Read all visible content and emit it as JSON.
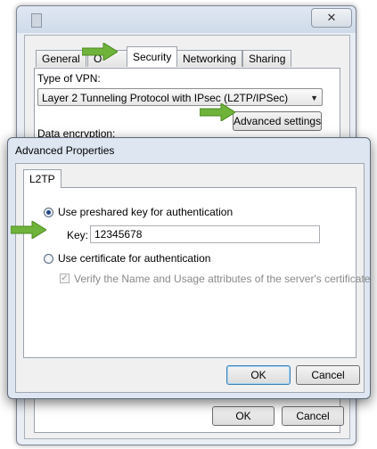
{
  "back_window": {
    "close_glyph": "✕",
    "tabs": [
      "General",
      "O",
      "Security",
      "Networking",
      "Sharing"
    ],
    "active_tab": "Security",
    "type_of_vpn_label": "Type of VPN:",
    "vpn_type_value": "Layer 2 Tunneling Protocol with IPsec (L2TP/IPSec)",
    "advanced_settings_label": "Advanced settings",
    "data_encryption_label": "Data encryption:",
    "ok_label": "OK",
    "cancel_label": "Cancel"
  },
  "dialog": {
    "title": "Advanced Properties",
    "tab": "L2TP",
    "use_preshared_key_label": "Use preshared key for authentication",
    "key_label": "Key:",
    "key_value": "12345678",
    "use_certificate_label": "Use certificate for authentication",
    "verify_label": "Verify the Name and Usage attributes of the server's certificate",
    "ok_label": "OK",
    "cancel_label": "Cancel"
  },
  "icons": {
    "dropdown": "chevron-down-icon",
    "pointer_arrow": "green-arrow-icon",
    "checkmark": "check-icon"
  },
  "colors": {
    "arrow_green": "#6fb33a",
    "title_bar": "#dde6f1",
    "accent_border": "#3c7fb1"
  }
}
